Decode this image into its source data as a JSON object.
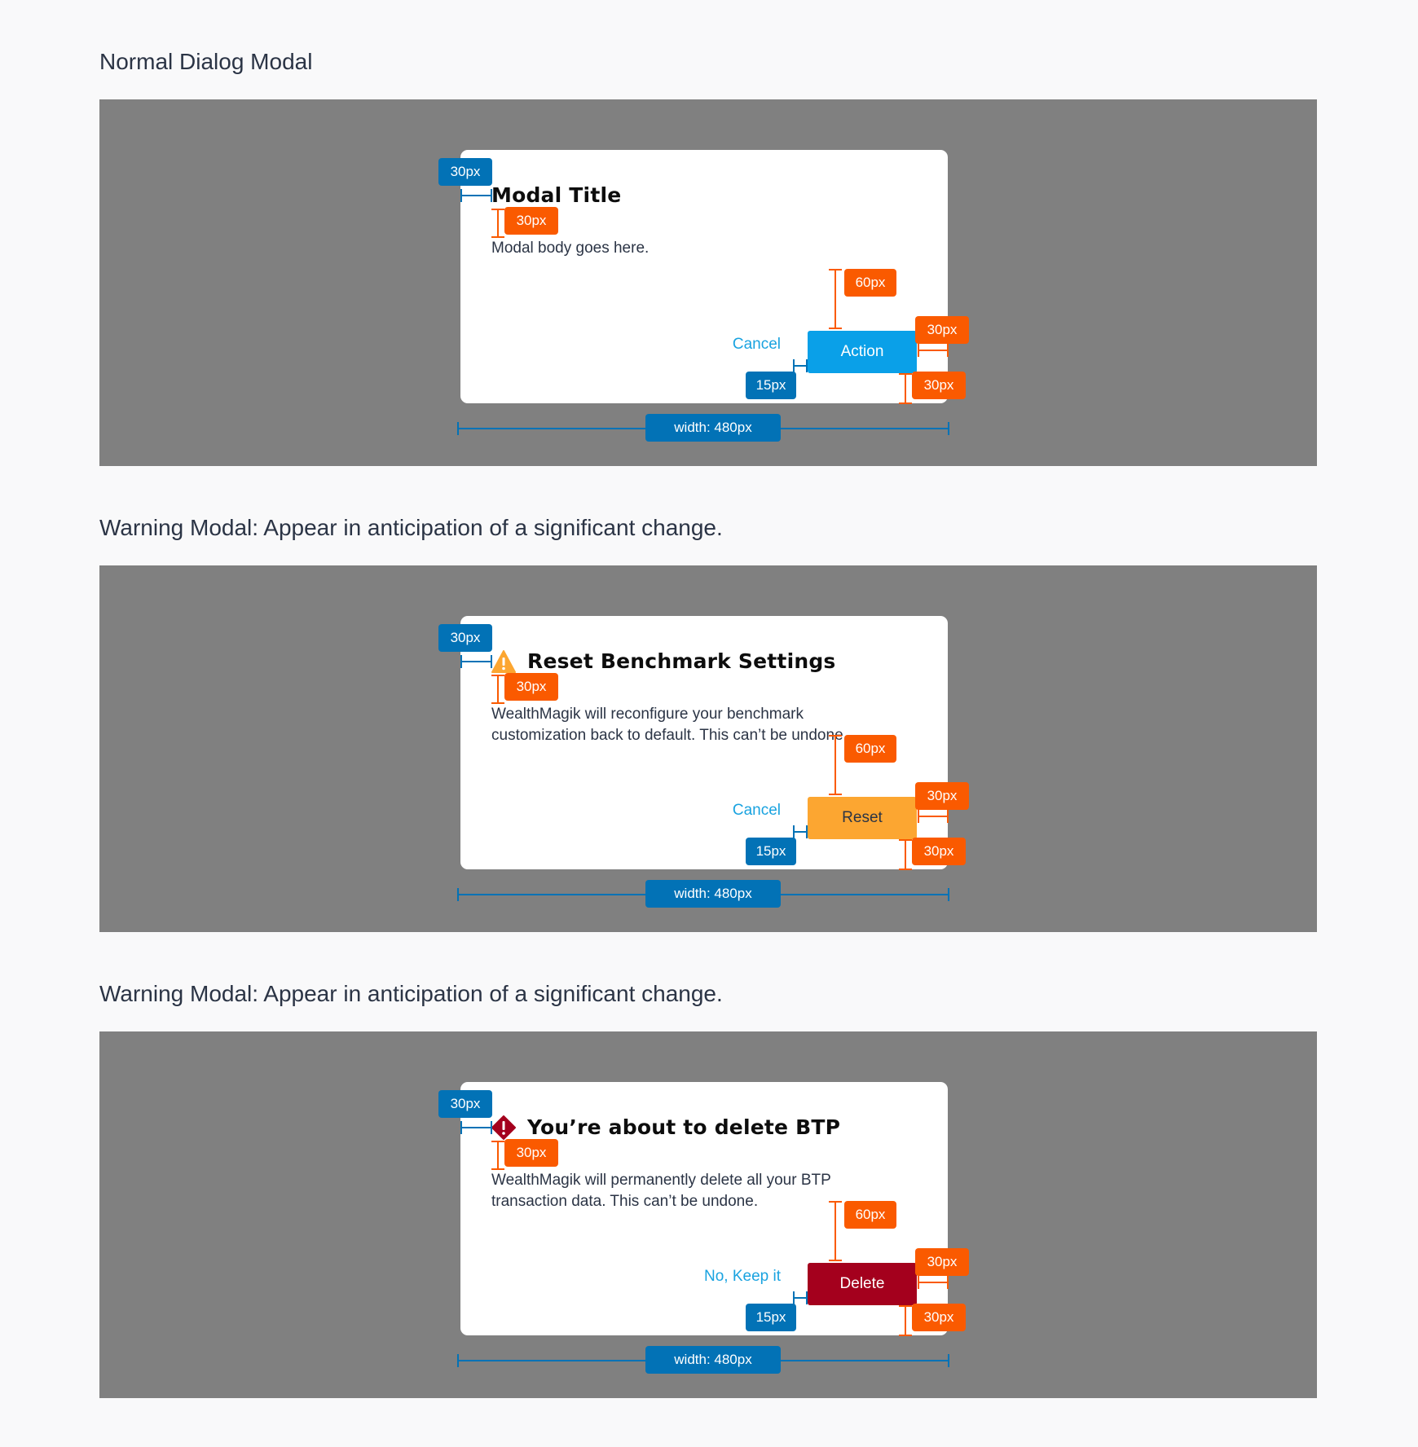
{
  "colors": {
    "page_bg": "#f9f9fa",
    "stage_bg": "#808080",
    "annotation_blue": "#0272b6",
    "annotation_orange": "#fa5a00",
    "primary_action": "#0aa0e8",
    "warning_action": "#fca631",
    "danger_action": "#a4001d",
    "link": "#1aa3e0"
  },
  "sections": [
    {
      "heading": "Normal Dialog Modal",
      "modal": {
        "icon": "",
        "title": "Modal Title",
        "body": "Modal body goes here.",
        "cancel_label": "Cancel",
        "action_label": "Action"
      }
    },
    {
      "heading": "Warning Modal: Appear in anticipation of a significant change.",
      "modal": {
        "icon": "warning-triangle-icon",
        "title": "Reset Benchmark Settings",
        "body": "WealthMagik will reconfigure your benchmark customization back to default. This can’t be undone.",
        "cancel_label": "Cancel",
        "action_label": "Reset"
      }
    },
    {
      "heading": "Warning Modal: Appear in anticipation of a significant change.",
      "modal": {
        "icon": "danger-diamond-icon",
        "title": "You’re about to delete BTP",
        "body": "WealthMagik will permanently delete all your BTP transaction data. This can’t be undone.",
        "cancel_label": "No, Keep it",
        "action_label": "Delete"
      }
    }
  ],
  "annotations": {
    "left_padding": "30px",
    "title_gap": "30px",
    "body_to_button": "60px",
    "right_padding": "30px",
    "bottom_padding": "30px",
    "button_gap": "15px",
    "width": "width: 480px"
  }
}
